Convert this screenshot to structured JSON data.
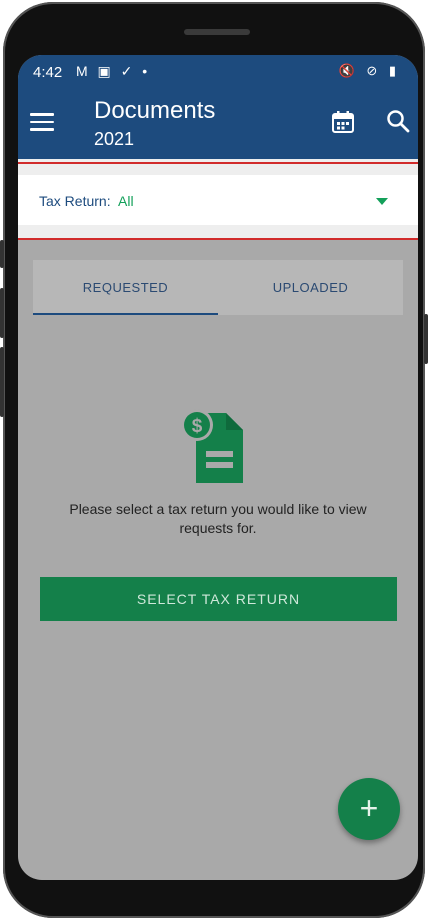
{
  "status_bar": {
    "time": "4:42",
    "left_icons": "M ▣ ✓ •",
    "right_icons": "🔇 ⊘ ▮"
  },
  "app_bar": {
    "title": "Documents",
    "subtitle": "2021"
  },
  "filter": {
    "label": "Tax Return:",
    "value": "All"
  },
  "tabs": [
    {
      "label": "REQUESTED",
      "selected": true
    },
    {
      "label": "UPLOADED",
      "selected": false
    }
  ],
  "empty_state": {
    "message": "Please select a tax return you would like to view requests for.",
    "button_label": "SELECT TAX RETURN"
  },
  "fab": {
    "label": "+"
  },
  "colors": {
    "primary": "#1d4b7e",
    "accent": "#14804a",
    "highlight": "#d12b2b"
  }
}
